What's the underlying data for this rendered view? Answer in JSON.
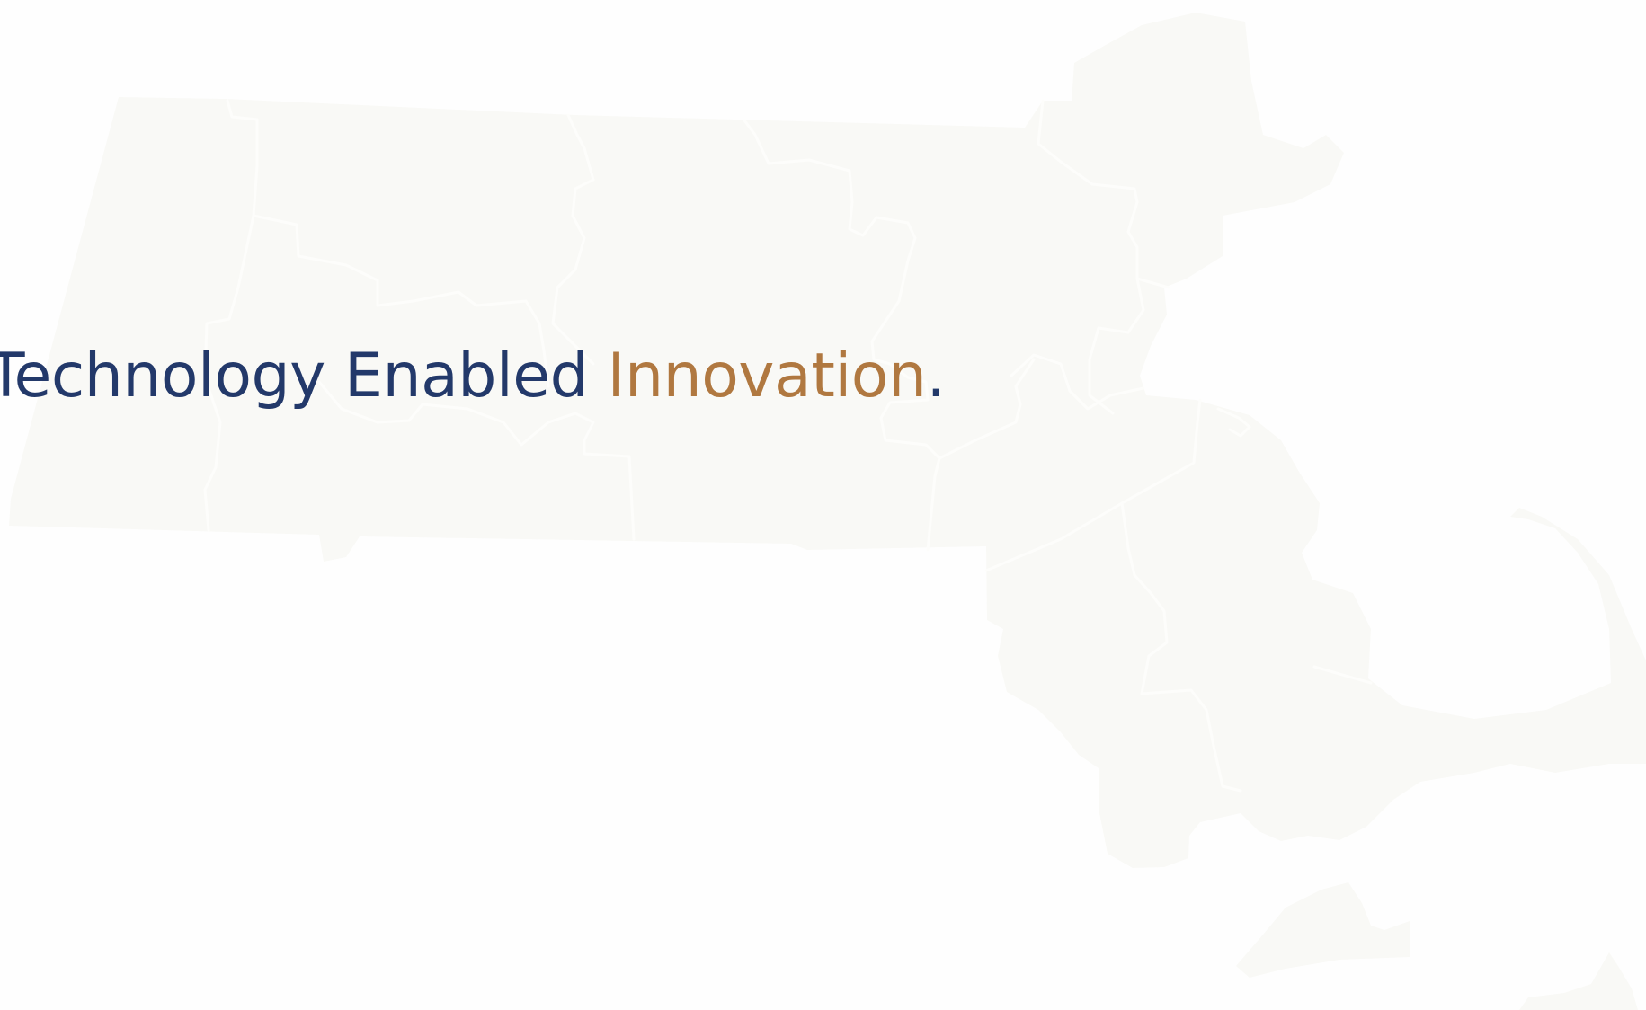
{
  "tagline": {
    "lead": "Technology Enabled ",
    "accent": "Innovation",
    "end": "."
  },
  "colors": {
    "background": "#fefefe",
    "map_fill": "#f9f9f6",
    "map_borders": "#fdfdfb",
    "navy": "#23396a",
    "gold": "#b07840"
  },
  "background_graphic": {
    "icon": "massachusetts-county-map"
  }
}
